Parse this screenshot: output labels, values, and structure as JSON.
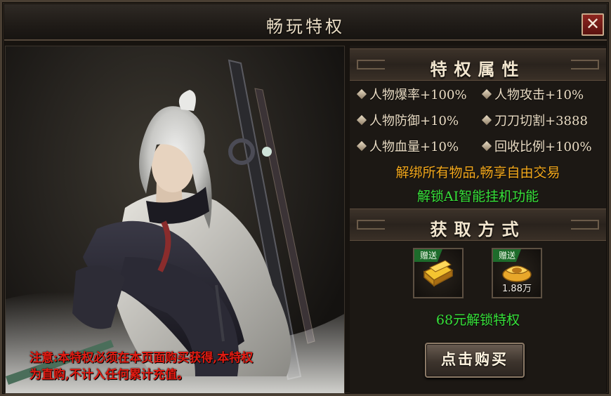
{
  "window": {
    "title": "畅玩特权",
    "close_icon": "close-icon"
  },
  "notice": {
    "line1": "注意:本特权必须在本页面购买获得,本特权",
    "line2": "为直购,不计入任何累计充值。"
  },
  "privilege": {
    "header": "特权属性",
    "attributes": [
      "人物爆率+100%",
      "人物攻击+10%",
      "人物防御+10%",
      "刀刀切割+3888",
      "人物血量+10%",
      "回收比例+100%"
    ],
    "highlight_gold": "解绑所有物品,畅享自由交易",
    "highlight_green": "解锁AI智能挂机功能"
  },
  "acquire": {
    "header": "获取方式",
    "items": [
      {
        "tag": "赠送",
        "icon": "gold-bars-icon",
        "qty": ""
      },
      {
        "tag": "赠送",
        "icon": "gold-ingot-icon",
        "qty": "1.88万"
      }
    ],
    "price_text": "68元解锁特权",
    "buy_label": "点击购买"
  },
  "colors": {
    "gold": "#f3a81c",
    "green": "#37e13a",
    "notice_red": "#e21b12",
    "tag_green": "#1d6b2b"
  }
}
